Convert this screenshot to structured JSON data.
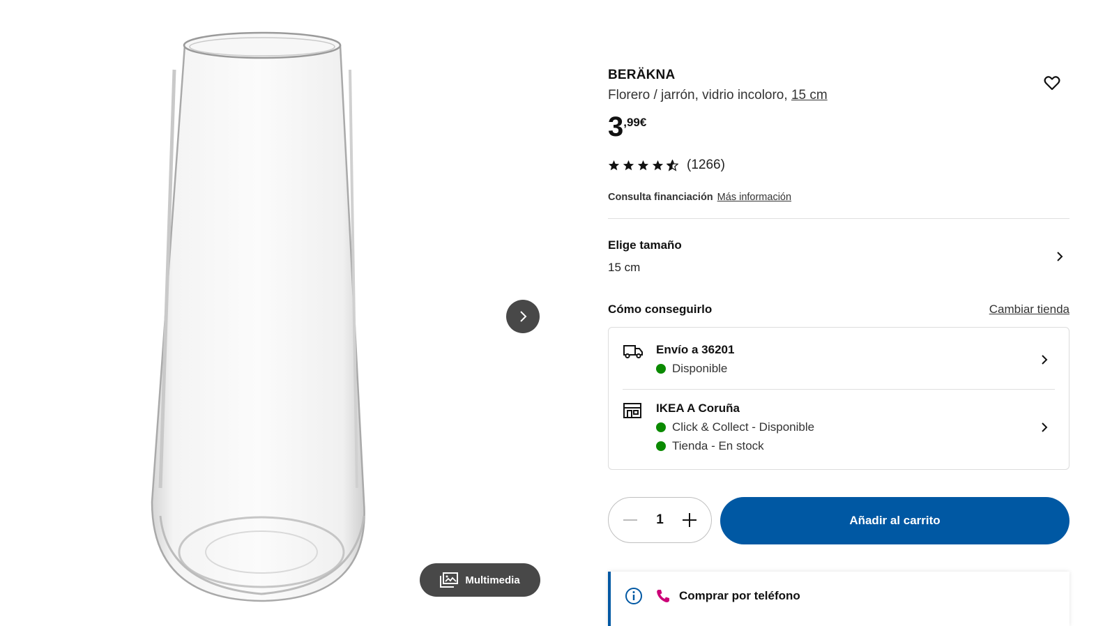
{
  "product": {
    "name": "BERÄKNA",
    "description": "Florero / jarrón, vidrio incoloro, ",
    "size_link": "15 cm",
    "price_int": "3",
    "price_dec": ",99€",
    "rating_value": 4.5,
    "review_count": "(1266)"
  },
  "gallery": {
    "next_icon": "chevron-right-icon",
    "media_label": "Multimedia",
    "media_icon": "image-gallery-icon"
  },
  "financing": {
    "label": "Consulta financiación",
    "link": "Más información"
  },
  "size_selector": {
    "title": "Elige tamaño",
    "value": "15 cm"
  },
  "fulfillment": {
    "title": "Cómo conseguirlo",
    "change_store": "Cambiar tienda",
    "delivery": {
      "title": "Envío a 36201",
      "status": "Disponible",
      "icon": "truck-icon"
    },
    "store": {
      "title": "IKEA A Coruña",
      "status_1": "Click & Collect - Disponible",
      "status_2": "Tienda - En stock",
      "icon": "store-icon"
    },
    "status_color": "#0a8a00"
  },
  "cart": {
    "quantity": "1",
    "add_label": "Añadir al carrito",
    "button_color": "#0058a3"
  },
  "phone": {
    "label": "Comprar por teléfono"
  }
}
